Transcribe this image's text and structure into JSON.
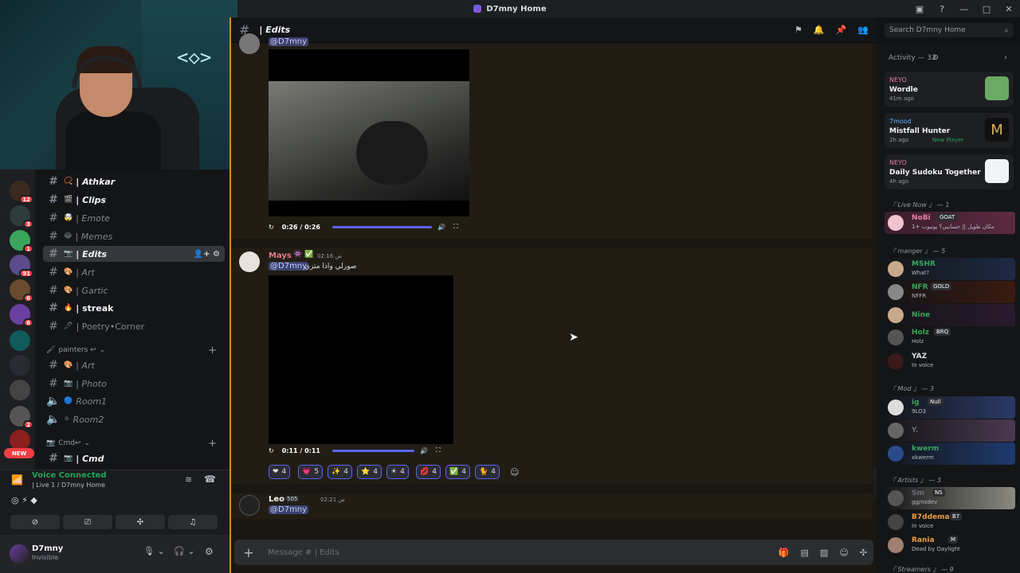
{
  "titlebar": {
    "title": "D7mny Home"
  },
  "server_badges": [
    "HOL?",
    "12",
    "3",
    "1",
    "91",
    "6",
    "6",
    "2"
  ],
  "new_badge": "NEW",
  "channels": [
    {
      "emoji": "📿",
      "name": "| Athkar",
      "state": "unread"
    },
    {
      "emoji": "🎬",
      "name": "| Clips",
      "state": "unread"
    },
    {
      "emoji": "🤯",
      "name": "| Emote",
      "state": "muted"
    },
    {
      "emoji": "😂",
      "name": "| Memes",
      "state": "muted"
    },
    {
      "emoji": "📷",
      "name": "| Edits",
      "state": "active"
    },
    {
      "emoji": "🎨",
      "name": "| Art",
      "state": "muted"
    },
    {
      "emoji": "🎨",
      "name": "| Gartic",
      "state": "muted"
    },
    {
      "emoji": "🔥",
      "name": "| streak",
      "state": "unread"
    },
    {
      "emoji": "🖊",
      "name": "| Poetry•Corner",
      "state": "muted"
    }
  ],
  "category_painters": "painters ↩",
  "painter_channels": [
    {
      "emoji": "🎨",
      "name": "| Art",
      "icon": "#"
    },
    {
      "emoji": "📷",
      "name": "| Photo",
      "icon": "#"
    },
    {
      "emoji": "🔵",
      "name": "Room1",
      "icon": "🔈"
    },
    {
      "emoji": "⚪",
      "name": "Room2",
      "icon": "🔈"
    }
  ],
  "category_cmd": "Cmd↩",
  "cmd_channel": {
    "emoji": "📷",
    "name": "| Cmd"
  },
  "voice": {
    "status": "Voice Connected",
    "sub": "| Live 1 / D7mny Home"
  },
  "user": {
    "name": "D7mny",
    "status": "Invisible"
  },
  "header": {
    "channel": "| Edits"
  },
  "search": {
    "placeholder": "Search D7mny Home"
  },
  "messages": [
    {
      "author": "",
      "mention": "@D7mny",
      "video_time": "0:26 / 0:26"
    },
    {
      "author": "Mays",
      "time": "02:16 ص",
      "mention": "@D7mny",
      "text": "صورلي واذا متزي",
      "video_time": "0:11 / 0:11"
    },
    {
      "author": "Leo",
      "badge": "505",
      "time": "02:21 ص",
      "mention": "@D7mny"
    }
  ],
  "reactions": [
    {
      "emoji": "❤",
      "count": "4"
    },
    {
      "emoji": "💗",
      "count": "5"
    },
    {
      "emoji": "✨",
      "count": "4"
    },
    {
      "emoji": "⭐",
      "count": "4"
    },
    {
      "emoji": "☀",
      "count": "4"
    },
    {
      "emoji": "💋",
      "count": "4"
    },
    {
      "emoji": "✅",
      "count": "4"
    },
    {
      "emoji": "🐈",
      "count": "4"
    }
  ],
  "composer": {
    "placeholder": "Message # | Edits"
  },
  "activity": {
    "header": "Activity — 32",
    "items": [
      {
        "who": "NEYO",
        "game": "Wordle",
        "ago": "41m ago",
        "extra": ""
      },
      {
        "who": "7mood",
        "game": "Mistfall Hunter",
        "ago": "2h ago",
        "extra": "New Player"
      },
      {
        "who": "NEYO",
        "game": "Daily Sudoku Together",
        "ago": "4h ago",
        "extra": ""
      }
    ]
  },
  "sections": {
    "live": "『 Live Now 』 — 1",
    "manger": "『 manger 』 — 5",
    "mod": "『 Mod 』 — 3",
    "artists": "『 Artists 』 — 3",
    "streamers": "『 Streamers 』 — 9"
  },
  "members": [
    {
      "name": "NoBi",
      "status": "مكان طويل || حسابيي؟ يوتيوب +1",
      "tag": "GOAT",
      "color": "#e47fa4"
    },
    {
      "name": "MSHR",
      "status": "What?",
      "tag": "",
      "color": "#3ba55c"
    },
    {
      "name": "NFR",
      "status": "NFFR",
      "tag": "GOLD",
      "color": "#3ba55c"
    },
    {
      "name": "Nine",
      "status": "",
      "tag": "",
      "color": "#3ba55c"
    },
    {
      "name": "Holz",
      "status": "Holz",
      "tag": "BRQ",
      "color": "#3ba55c"
    },
    {
      "name": "YAZ",
      "status": "In voice",
      "tag": "",
      "color": "#dbdee1"
    },
    {
      "name": "ig",
      "status": "9LO3",
      "tag": "Null",
      "color": "#3ba55c"
    },
    {
      "name": "Y.",
      "status": "",
      "tag": "",
      "color": "#6d6f78"
    },
    {
      "name": "kwerm",
      "status": "xkwerm",
      "tag": "",
      "color": "#3ba55c"
    },
    {
      "name": "Sm",
      "status": "gg/nsdev",
      "tag": "NS",
      "color": "#6d6f78"
    },
    {
      "name": "B7ddema",
      "status": "In voice",
      "tag": "B7",
      "color": "#e89a46"
    },
    {
      "name": "Rania",
      "status": "Dead by Daylight",
      "tag": "M",
      "color": "#e89a46"
    }
  ]
}
